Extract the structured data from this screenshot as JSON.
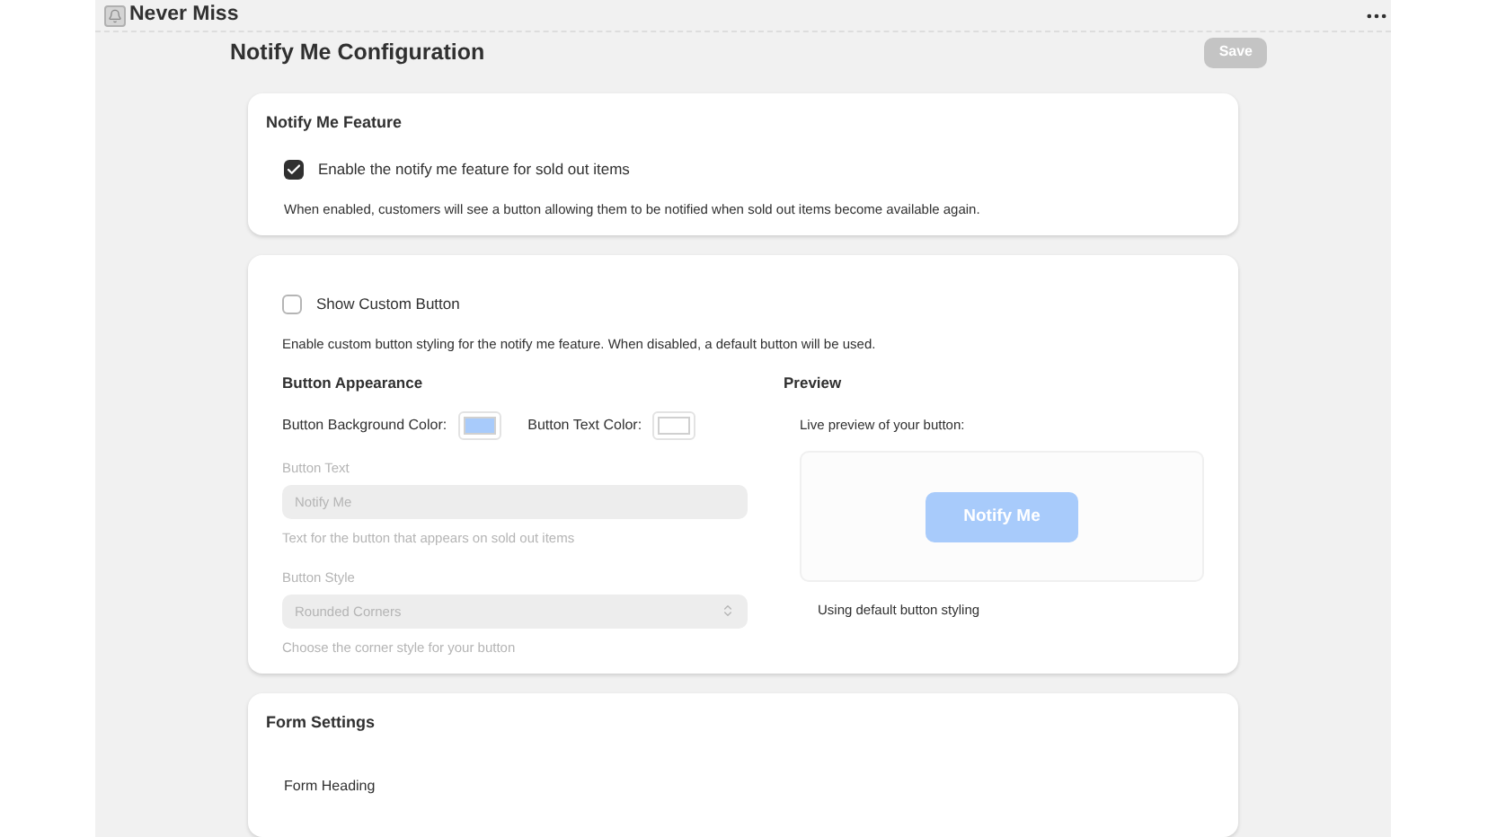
{
  "app": {
    "title": "Never Miss"
  },
  "page": {
    "title": "Notify Me Configuration",
    "save_button": {
      "label": "Save",
      "disabled": true
    }
  },
  "feature_card": {
    "title": "Notify Me Feature",
    "checkbox": {
      "label": "Enable the notify me feature for sold out items",
      "checked": true
    },
    "help": "When enabled, customers will see a button allowing them to be notified when sold out items become available again."
  },
  "custom_card": {
    "checkbox": {
      "label": "Show Custom Button",
      "checked": false
    },
    "help": "Enable custom button styling for the notify me feature. When disabled, a default button will be used.",
    "appearance": {
      "title": "Button Appearance",
      "swatches": [
        {
          "label": "Button Background Color:",
          "color": "#a8cbfb"
        },
        {
          "label": "Button Text Color:",
          "color": "#ffffff"
        }
      ],
      "button_text": {
        "label": "Button Text",
        "value": "Notify Me",
        "help": "Text for the button that appears on sold out items",
        "disabled": true
      },
      "button_style": {
        "label": "Button Style",
        "value": "Rounded Corners",
        "help": "Choose the corner style for your button",
        "disabled": true
      }
    },
    "preview": {
      "title": "Preview",
      "caption": "Live preview of your button:",
      "button": {
        "label": "Notify Me",
        "color": "#a8cbfb"
      },
      "note": "Using default button styling"
    }
  },
  "form_card": {
    "title": "Form Settings",
    "field_label": "Form Heading"
  }
}
